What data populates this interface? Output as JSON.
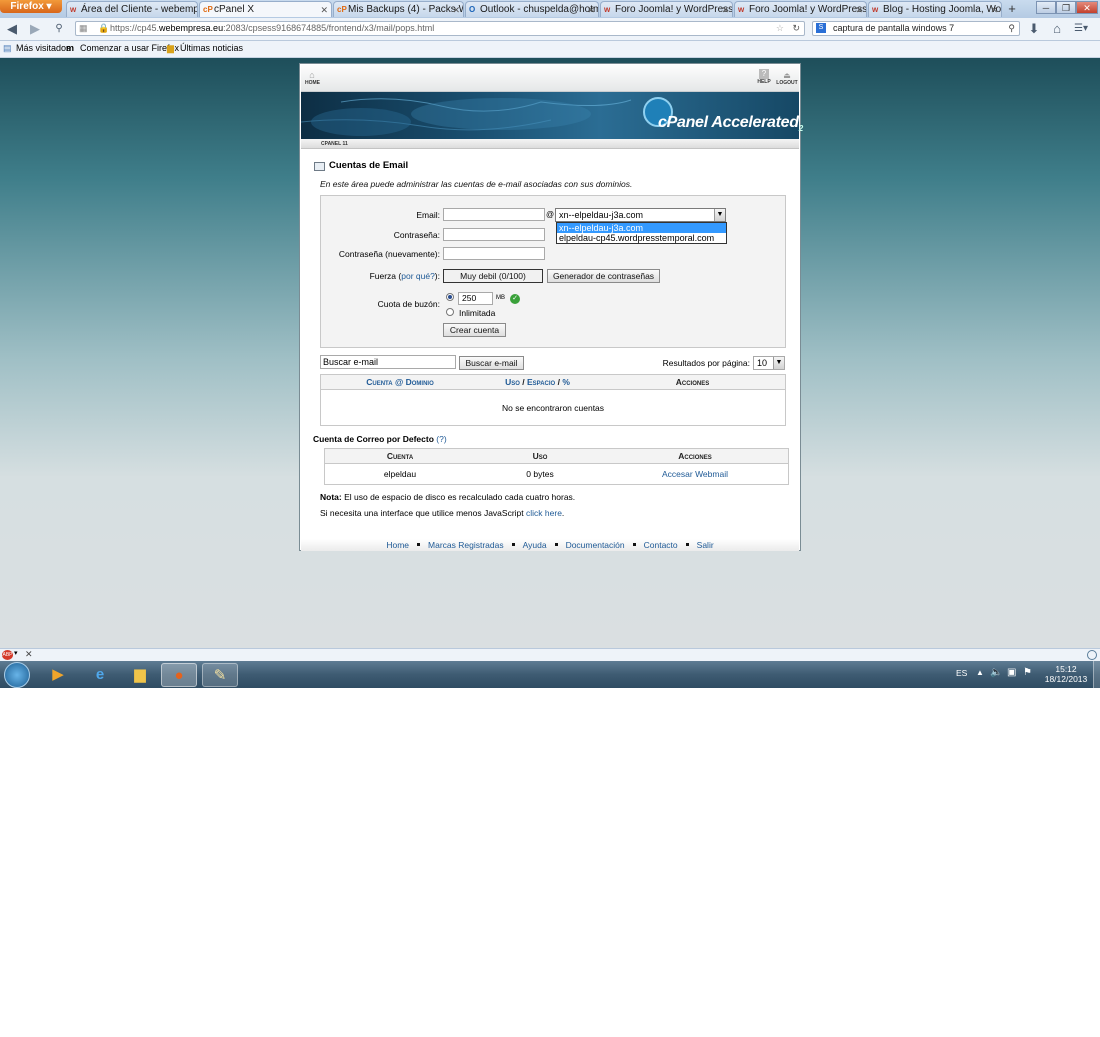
{
  "browser": {
    "menu_button": "Firefox",
    "tabs": [
      {
        "label": "Área del Cliente - webempre...",
        "icon": "w"
      },
      {
        "label": "cPanel X",
        "icon": "cP",
        "active": true
      },
      {
        "label": "Mis Backups (4) - Packs Web...",
        "icon": "cP"
      },
      {
        "label": "Outlook - chuspelda@hotm...",
        "icon": "O"
      },
      {
        "label": "Foro Joomla! y WordPress :: ...",
        "icon": "w"
      },
      {
        "label": "Foro Joomla! y WordPress :: ...",
        "icon": "w"
      },
      {
        "label": "Blog - Hosting Joomla, Wor...",
        "icon": "w"
      }
    ],
    "new_tab": "+",
    "url_prefix": "https://cp45.",
    "url_host": "webempresa.eu",
    "url_rest": ":2083/cpsess9168674885/frontend/x3/mail/pops.html",
    "search_value": "captura de pantalla windows 7",
    "bookmarks": [
      "Más visitados",
      "Comenzar a usar Firefox",
      "Últimas noticias"
    ]
  },
  "cpanel": {
    "top_links": {
      "home": "HOME",
      "help": "HELP",
      "logout": "LOGOUT"
    },
    "banner_logo": "cPanel Accelerated",
    "banner_sub": "2",
    "version_tag": "CPANEL 11",
    "title": "Cuentas de Email",
    "description": "En este área puede administrar las cuentas de e-mail asociadas con sus dominios.",
    "form": {
      "email_label": "Email:",
      "at": "@",
      "domain_selected": "xn--elpeldau-j3a.com",
      "domain_options": [
        "xn--elpeldau-j3a.com",
        "elpeldau-cp45.wordpresstemporal.com"
      ],
      "password_label": "Contraseña:",
      "password_again_label": "Contraseña (nuevamente):",
      "strength_label": "Fuerza (",
      "strength_link": "por qué?",
      "strength_label_end": "):",
      "strength_value": "Muy debil (0/100)",
      "generator_button": "Generador de contraseñas",
      "quota_label": "Cuota de buzón:",
      "quota_value": "250",
      "quota_unit": "MB",
      "unlimited_label": "Inlimitada",
      "create_button": "Crear cuenta"
    },
    "search": {
      "value": "Buscar e-mail",
      "button": "Buscar e-mail",
      "per_page_label": "Resultados por página:",
      "per_page_value": "10"
    },
    "accounts_table": {
      "col_account": "Cuenta @ Dominio",
      "col_usage_1": "Uso",
      "col_usage_sep": "/",
      "col_usage_2": "Espacio",
      "col_usage_3": "%",
      "col_actions": "Acciones",
      "empty_text": "No se encontraron cuentas"
    },
    "default_section": {
      "title": "Cuenta de Correo por Defecto",
      "help": "(?)",
      "headers": [
        "Cuenta",
        "Uso",
        "Acciones"
      ],
      "row": {
        "account": "elpeldau",
        "usage": "0 bytes",
        "action": "Accesar Webmail"
      }
    },
    "note_bold": "Nota:",
    "note_text": " El uso de espacio de disco es recalculado cada cuatro horas.",
    "js_text": "Si necesita una interface que utilice menos JavaScript ",
    "js_link": "click here",
    "footer": [
      "Home",
      "Marcas Registradas",
      "Ayuda",
      "Documentación",
      "Contacto",
      "Salir"
    ]
  },
  "taskbar": {
    "language": "ES",
    "time": "15:12",
    "date": "18/12/2013"
  }
}
